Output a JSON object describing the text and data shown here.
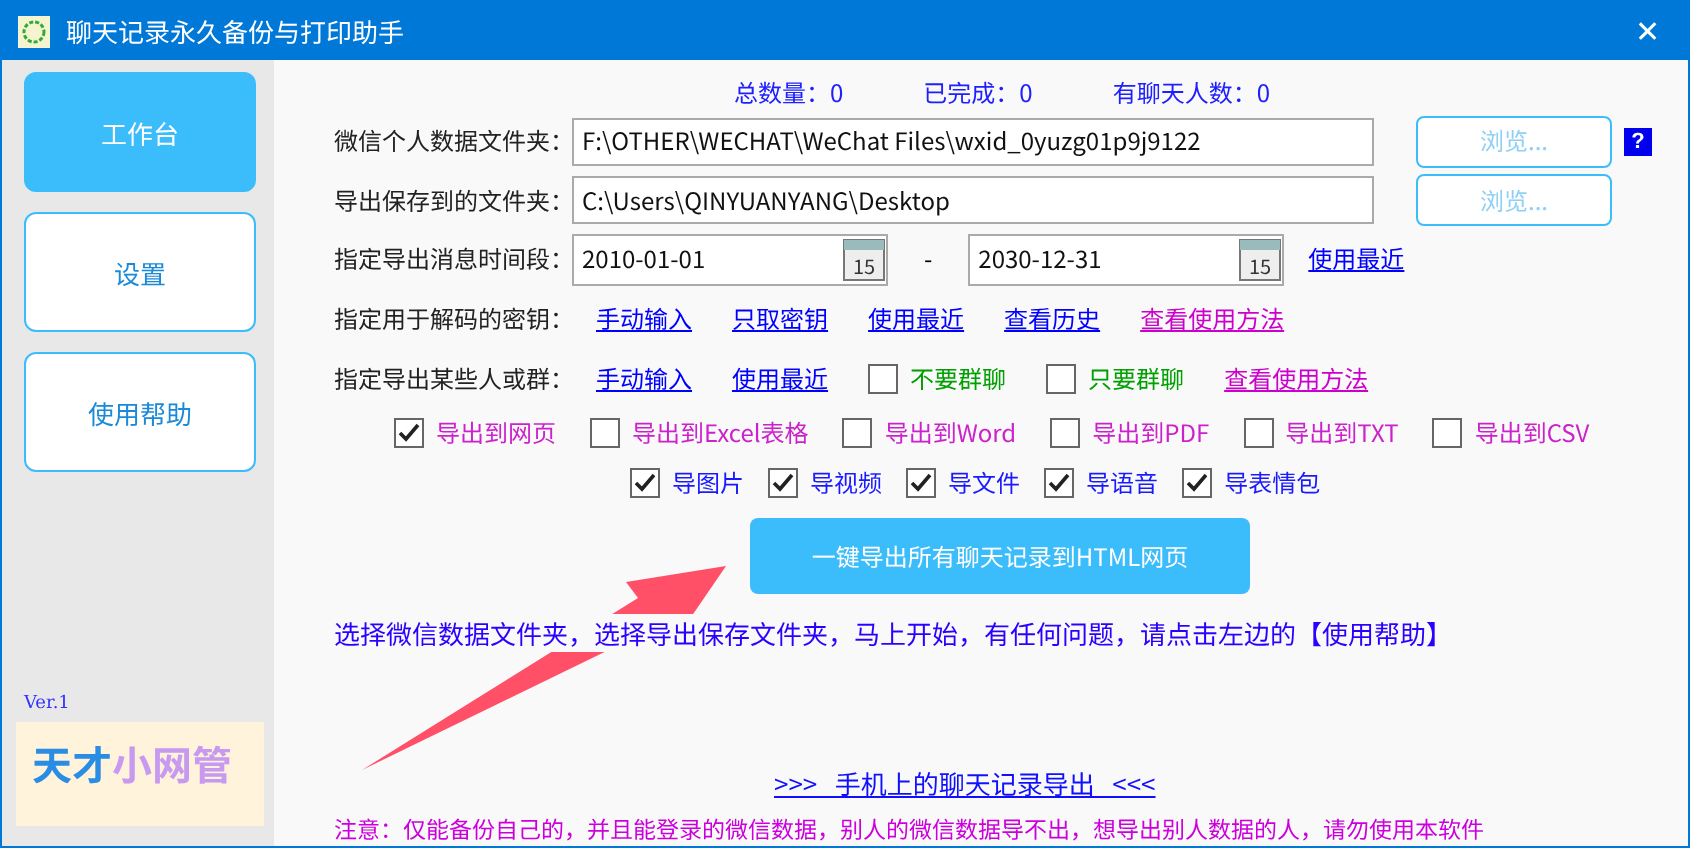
{
  "window": {
    "title": "聊天记录永久备份与打印助手",
    "close": "✕"
  },
  "sidebar": {
    "items": [
      {
        "label": "工作台",
        "selected": true
      },
      {
        "label": "设置",
        "selected": false
      },
      {
        "label": "使用帮助",
        "selected": false
      }
    ],
    "version": "Ver.1",
    "logo": {
      "first": "天才",
      "second": "小网管"
    }
  },
  "stats": [
    "总数量：0",
    "已完成：0",
    "有聊天人数：0"
  ],
  "folders": [
    {
      "label": "微信个人数据文件夹：",
      "value": "F:\\OTHER\\WECHAT\\WeChat Files\\wxid_0yuzg01p9j9122",
      "button": "浏览...",
      "help": "?"
    },
    {
      "label": "导出保存到的文件夹：",
      "value": "C:\\Users\\QINYUANYANG\\Desktop",
      "button": "浏览..."
    }
  ],
  "date_range": {
    "label": "指定导出消息时间段：",
    "start": "2010-01-01",
    "start_calendar": "15",
    "separator": "-",
    "end": "2030-12-31",
    "end_calendar": "15",
    "link": "使用最近"
  },
  "key_row": {
    "label": "指定用于解码的密钥：",
    "items": [
      {
        "kind": "link",
        "text": "手动输入",
        "color": "#0000ff"
      },
      {
        "kind": "link",
        "text": "只取密钥",
        "color": "#0000ff"
      },
      {
        "kind": "link",
        "text": "使用最近",
        "color": "#0000ff"
      },
      {
        "kind": "link",
        "text": "查看历史",
        "color": "#0000ff"
      },
      {
        "kind": "link",
        "text": "查看使用方法",
        "color": "#cc00cc"
      }
    ]
  },
  "group_row": {
    "label": "指定导出某些人或群：",
    "items": [
      {
        "kind": "link",
        "text": "手动输入",
        "color": "#0000ff"
      },
      {
        "kind": "link",
        "text": "使用最近",
        "color": "#0000ff"
      },
      {
        "kind": "checkbox",
        "text": "不要群聊",
        "checked": false,
        "color": "#00a000"
      },
      {
        "kind": "checkbox",
        "text": "只要群聊",
        "checked": false,
        "color": "#00a000"
      },
      {
        "kind": "link",
        "text": "查看使用方法",
        "color": "#cc00cc"
      }
    ]
  },
  "formats": [
    {
      "label": "导出到网页",
      "checked": true
    },
    {
      "label": "导出到Excel表格",
      "checked": false
    },
    {
      "label": "导出到Word",
      "checked": false
    },
    {
      "label": "导出到PDF",
      "checked": false
    },
    {
      "label": "导出到TXT",
      "checked": false
    },
    {
      "label": "导出到CSV",
      "checked": false
    }
  ],
  "media": [
    {
      "label": "导图片",
      "checked": true
    },
    {
      "label": "导视频",
      "checked": true
    },
    {
      "label": "导文件",
      "checked": true
    },
    {
      "label": "导语音",
      "checked": true
    },
    {
      "label": "导表情包",
      "checked": true
    }
  ],
  "export_button": "一键导出所有聊天记录到HTML网页",
  "instruction": "选择微信数据文件夹，选择导出保存文件夹，马上开始，有任何问题，请点击左边的【使用帮助】",
  "phone_link": ">>>   手机上的聊天记录导出   <<<",
  "notice": "注意：仅能备份自己的，并且能登录的微信数据，别人的微信数据导不出，想导出别人数据的人，请勿使用本软件"
}
